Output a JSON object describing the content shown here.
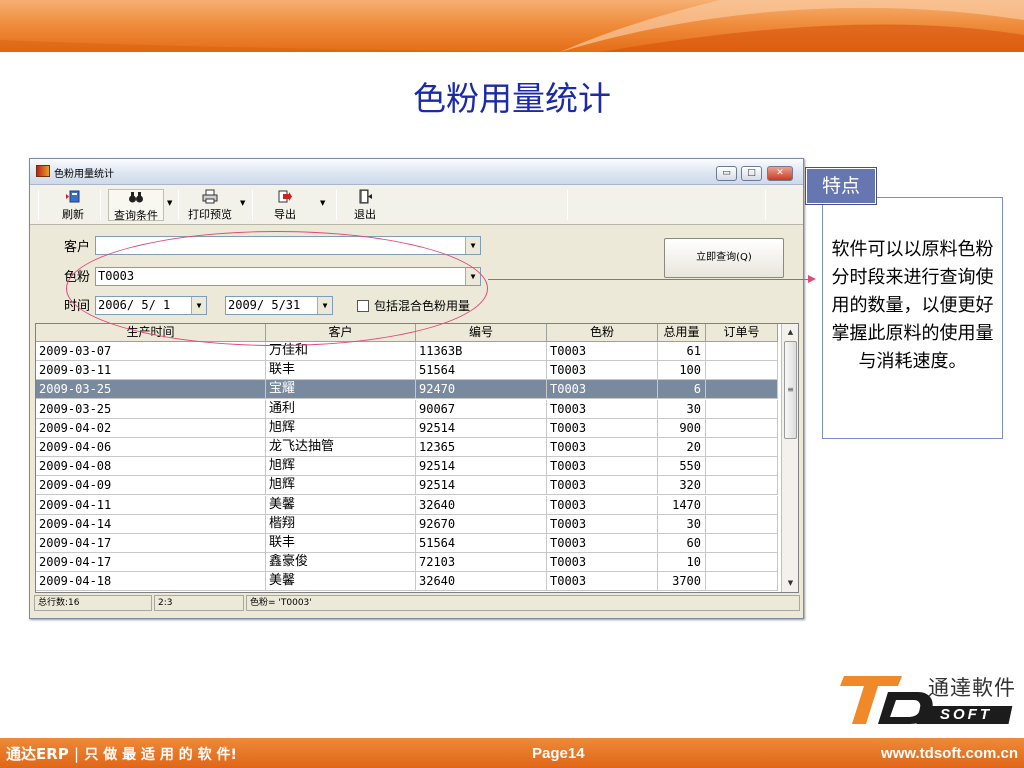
{
  "slide": {
    "title": "色粉用量统计"
  },
  "window": {
    "title": "色粉用量统计",
    "min_label": "▭",
    "max_label": "□",
    "close_label": "✕"
  },
  "toolbar": {
    "refresh": "刷新",
    "query_conditions": "查询条件",
    "print_preview": "打印预览",
    "export": "导出",
    "exit": "退出"
  },
  "form": {
    "customer_label": "客户",
    "customer_value": "",
    "powder_label": "色粉",
    "powder_value": "T0003",
    "time_label": "时间",
    "date_from": "2006/ 5/ 1",
    "date_to": "2009/ 5/31",
    "include_mixed_label": "包括混合色粉用量",
    "include_mixed_checked": false,
    "query_button": "立即查询(Q)"
  },
  "grid": {
    "columns": [
      "生产时间",
      "客户",
      "编号",
      "色粉",
      "总用量",
      "订单号"
    ],
    "rows": [
      [
        "2009-03-07",
        "万佳和",
        "11363B",
        "T0003",
        "61",
        ""
      ],
      [
        "2009-03-11",
        "联丰",
        "51564",
        "T0003",
        "100",
        ""
      ],
      [
        "2009-03-25",
        "宝耀",
        "92470",
        "T0003",
        "6",
        ""
      ],
      [
        "2009-03-25",
        "通利",
        "90067",
        "T0003",
        "30",
        ""
      ],
      [
        "2009-04-02",
        "旭辉",
        "92514",
        "T0003",
        "900",
        ""
      ],
      [
        "2009-04-06",
        "龙飞达抽管",
        "12365",
        "T0003",
        "20",
        ""
      ],
      [
        "2009-04-08",
        "旭辉",
        "92514",
        "T0003",
        "550",
        ""
      ],
      [
        "2009-04-09",
        "旭辉",
        "92514",
        "T0003",
        "320",
        ""
      ],
      [
        "2009-04-11",
        "美馨",
        "32640",
        "T0003",
        "1470",
        ""
      ],
      [
        "2009-04-14",
        "楷翔",
        "92670",
        "T0003",
        "30",
        ""
      ],
      [
        "2009-04-17",
        "联丰",
        "51564",
        "T0003",
        "60",
        ""
      ],
      [
        "2009-04-17",
        "鑫豪俊",
        "72103",
        "T0003",
        "10",
        ""
      ],
      [
        "2009-04-18",
        "美馨",
        "32640",
        "T0003",
        "3700",
        ""
      ]
    ],
    "selected_row": 2
  },
  "status": {
    "total": "总行数:16",
    "pos": "2:3",
    "filter": "色粉= 'T0003'"
  },
  "feature": {
    "tag": "特点",
    "text": "软件可以以原料色粉分时段来进行查询使用的数量，以便更好掌握此原料的使用量与消耗速度。"
  },
  "logo": {
    "cn": "通達軟件",
    "en": "SOFT",
    "mark": "TD"
  },
  "footer": {
    "brand": "通达ERP",
    "slogan": "只 做 最 适 用 的 软 件!",
    "page": "Page14",
    "url": "www.tdsoft.com.cn"
  },
  "colors": {
    "title_blue": "#1a2aa8",
    "orange": "#e56d17",
    "highlight_pink": "#e04a7a",
    "selected_row": "#7a8a9e",
    "feature_blue": "#6676b0"
  }
}
